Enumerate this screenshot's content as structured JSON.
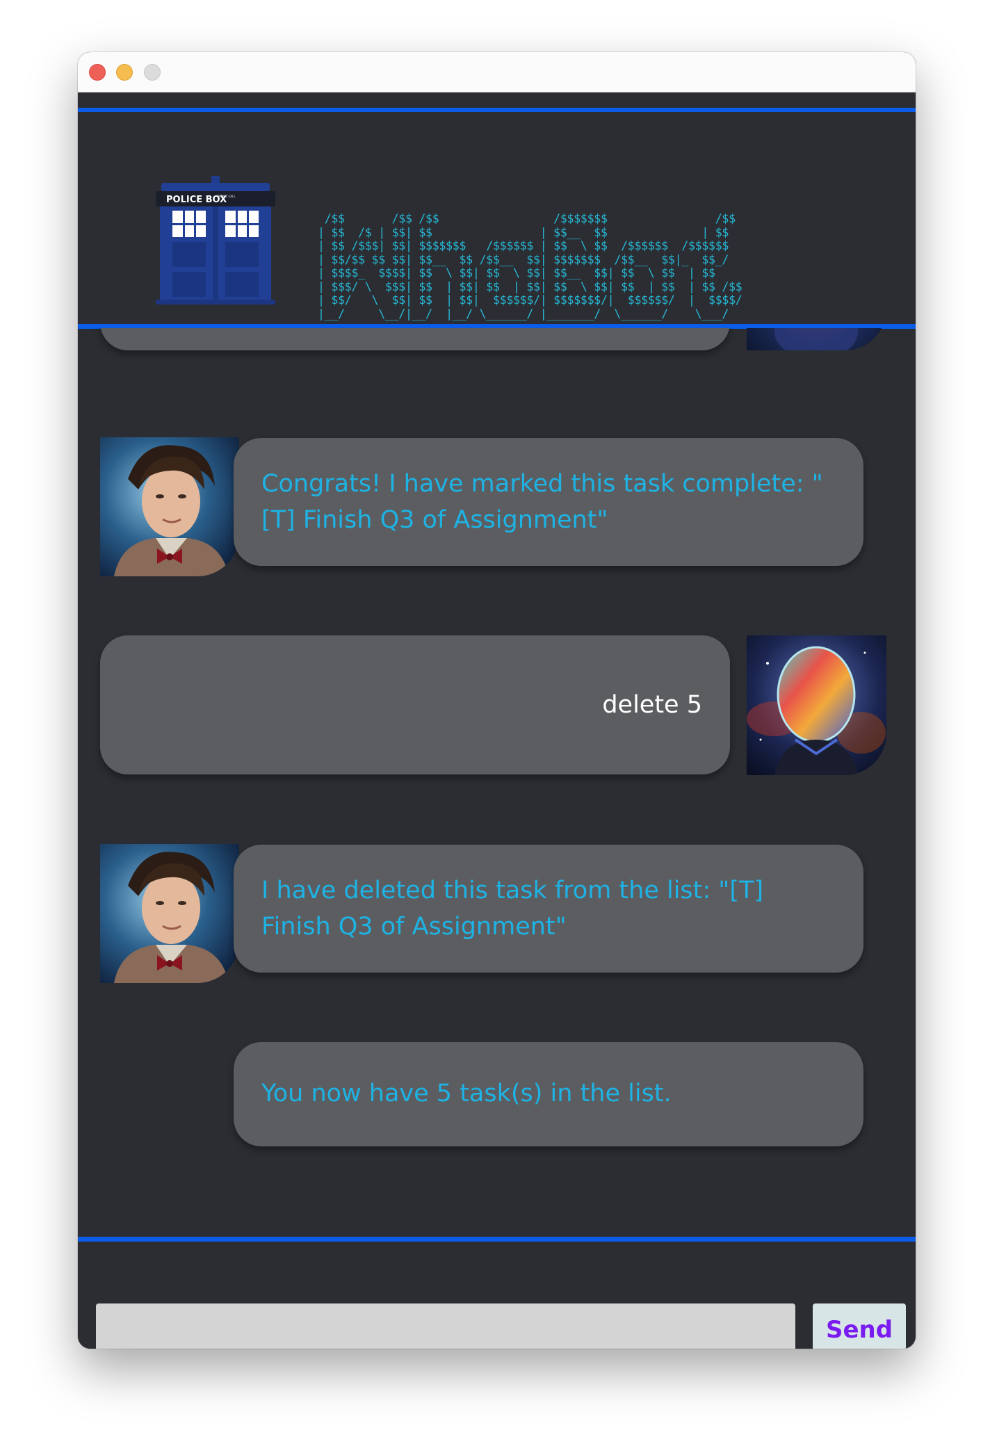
{
  "header": {
    "ascii_banner": " /$$       /$$ /$$                 /$$$$$$$                /$$\n| $$  /$ | $$| $$                | $$__  $$              | $$\n| $$ /$$$| $$| $$$$$$$   /$$$$$$ | $$  \\ $$  /$$$$$$  /$$$$$$\n| $$/$$ $$ $$| $$__  $$ /$$__  $$| $$$$$$$  /$$__  $$|_  $$_/\n| $$$$_  $$$$| $$  \\ $$| $$  \\ $$| $$__  $$| $$  \\ $$  | $$\n| $$$/ \\  $$$| $$  | $$| $$  | $$| $$  \\ $$| $$  | $$  | $$ /$$\n| $$/   \\  $$| $$  | $$|  $$$$$$/| $$$$$$$/|  $$$$$$/  |  $$$$/\n|__/     \\__/|__/  |__/ \\______/ |_______/  \\______/    \\___/",
    "tardis_sign": "POLICE BOX",
    "tardis_small_sign": "PUBLIC CALL"
  },
  "messages": [
    {
      "sender": "bot",
      "text": "Congrats! I have marked this task complete: \"[T] Finish Q3 of Assignment\""
    },
    {
      "sender": "user",
      "text": "delete 5"
    },
    {
      "sender": "bot",
      "text": "I have deleted this task from the list: \"[T] Finish Q3 of Assignment\""
    },
    {
      "sender": "bot",
      "text": "You now have 5 task(s) in the list."
    }
  ],
  "input": {
    "value": "",
    "placeholder": ""
  },
  "send_button": {
    "label": "Send"
  },
  "colors": {
    "accent_line": "#0b5ce8",
    "bot_text": "#1eb3e4",
    "user_text": "#ffffff",
    "bubble": "#5b5d60",
    "background": "#2b2d32",
    "send_label": "#7a1bf0"
  }
}
